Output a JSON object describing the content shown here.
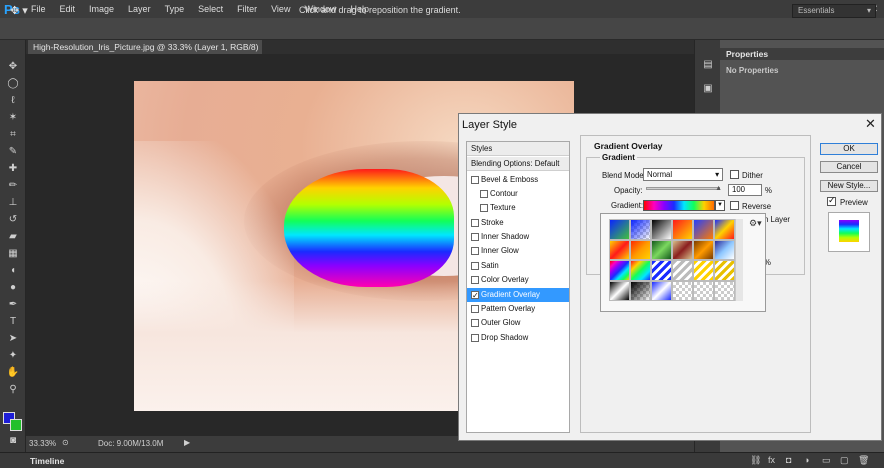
{
  "app": {
    "logo": "Ps"
  },
  "menu": [
    "File",
    "Edit",
    "Image",
    "Layer",
    "Type",
    "Select",
    "Filter",
    "View",
    "Window",
    "Help"
  ],
  "window_controls": {
    "minimize": "—",
    "restore": "❐",
    "close": "✕"
  },
  "options_bar": {
    "hint": "Click and drag to reposition the gradient.",
    "workspace": "Essentials"
  },
  "document": {
    "tab_title": "High-Resolution_Iris_Picture.jpg @ 33.3% (Layer 1, RGB/8) *",
    "tab_close": "×"
  },
  "status": {
    "zoom": "33.33%",
    "doc_size": "Doc: 9.00M/13.0M",
    "arrow": "▶"
  },
  "timeline": {
    "label": "Timeline"
  },
  "properties_panel": {
    "title": "Properties",
    "empty_text": "No Properties"
  },
  "colors": {
    "foreground": "#1d1dd6",
    "background": "#22c02b",
    "selection": "#3399ff",
    "accent": "#29a3ff"
  },
  "layer_style": {
    "title": "Layer Style",
    "close": "✕",
    "styles_header": "Styles",
    "blending_options": "Blending Options: Default",
    "items": [
      {
        "label": "Bevel & Emboss",
        "checked": false,
        "indent": 0
      },
      {
        "label": "Contour",
        "checked": false,
        "indent": 1
      },
      {
        "label": "Texture",
        "checked": false,
        "indent": 1
      },
      {
        "label": "Stroke",
        "checked": false,
        "indent": 0
      },
      {
        "label": "Inner Shadow",
        "checked": false,
        "indent": 0
      },
      {
        "label": "Inner Glow",
        "checked": false,
        "indent": 0
      },
      {
        "label": "Satin",
        "checked": false,
        "indent": 0
      },
      {
        "label": "Color Overlay",
        "checked": false,
        "indent": 0
      },
      {
        "label": "Gradient Overlay",
        "checked": true,
        "indent": 0,
        "selected": true
      },
      {
        "label": "Pattern Overlay",
        "checked": false,
        "indent": 0
      },
      {
        "label": "Outer Glow",
        "checked": false,
        "indent": 0
      },
      {
        "label": "Drop Shadow",
        "checked": false,
        "indent": 0
      }
    ],
    "gradient_overlay": {
      "title": "Gradient Overlay",
      "section": "Gradient",
      "blend_mode_label": "Blend Mode:",
      "blend_mode_value": "Normal",
      "opacity_label": "Opacity:",
      "opacity_value": "100",
      "opacity_unit": "%",
      "gradient_label": "Gradient:",
      "dither_label": "Dither",
      "dither_checked": false,
      "reverse_label": "Reverse",
      "reverse_checked": false,
      "peek_text_1": "h Layer",
      "peek_text_2": "%"
    },
    "buttons": {
      "ok": "OK",
      "cancel": "Cancel",
      "new_style": "New Style..."
    },
    "preview_label": "Preview",
    "preview_checked": true,
    "gear_icon": "gear-icon"
  }
}
